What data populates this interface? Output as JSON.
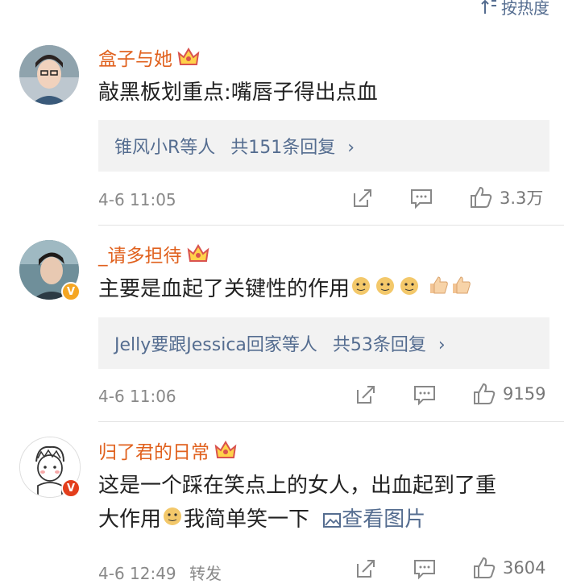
{
  "sort": {
    "label": "按热度"
  },
  "comments": [
    {
      "username": "盒子与她",
      "text": "敲黑板划重点:嘴唇子得出点血",
      "reply_people": "锥风小R等人",
      "reply_count": "共151条回复",
      "time": "4-6 11:05",
      "likes": "3.3万"
    },
    {
      "username": "_请多担待",
      "text": "主要是血起了关键性的作用",
      "reply_people": "Jelly要跟Jessica回家等人",
      "reply_count": "共53条回复",
      "time": "4-6 11:06",
      "likes": "9159"
    },
    {
      "username": "归了君的日常",
      "text_line1": "这是一个踩在笑点上的女人，出血起到了重",
      "text_line2a": "大作用",
      "text_line2b": "我简单笑一下",
      "view_image": "查看图片",
      "time": "4-6 12:49",
      "forward": "转发",
      "likes": "3604"
    }
  ],
  "colors": {
    "username": "#e0611e",
    "link": "#556d90",
    "reply_bg": "#f2f2f2"
  }
}
